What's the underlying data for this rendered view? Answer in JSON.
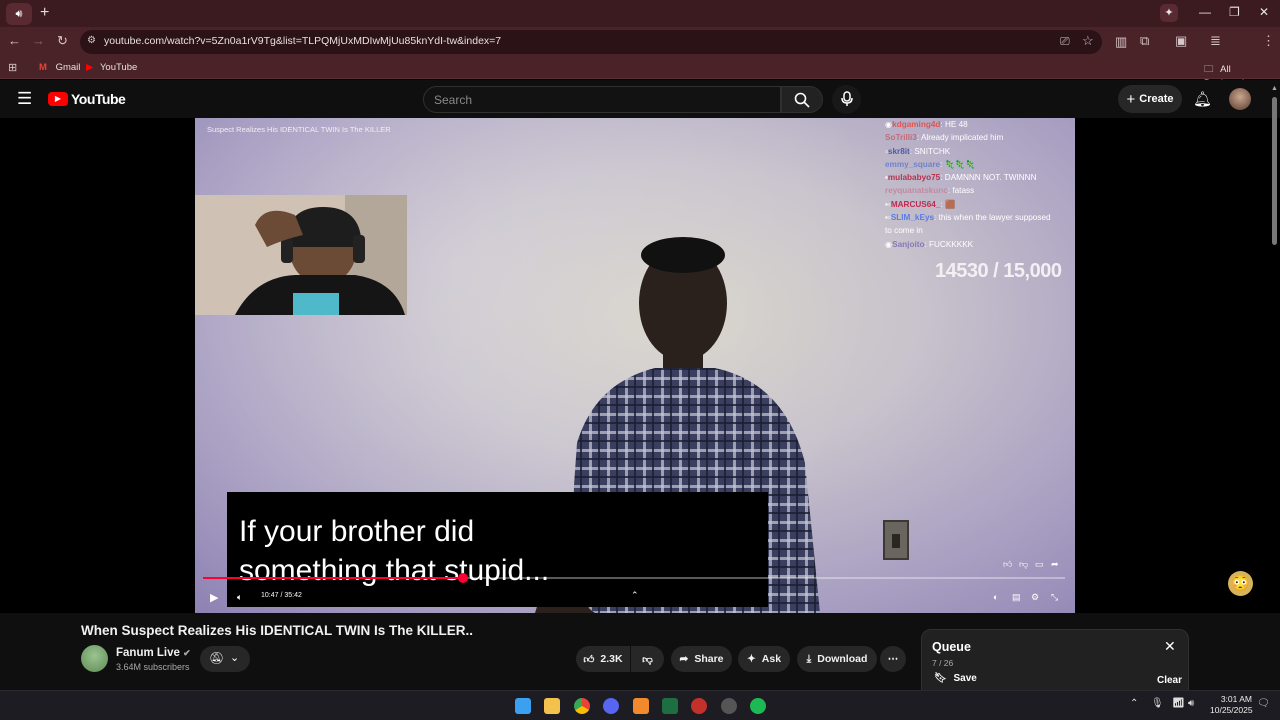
{
  "browser": {
    "url": "youtube.com/watch?v=5Zn0a1rV9Tg&list=TLPQMjUxMDIwMjUu85knYdI-tw&index=7",
    "bookmarks": [
      "Gmail",
      "YouTube"
    ],
    "all_bookmarks": "All Bookmarks",
    "new_tab": "+",
    "window_controls": [
      "—",
      "❐",
      "✕"
    ]
  },
  "youtube": {
    "logo_text": "YouTube",
    "search_placeholder": "Search",
    "create_label": "Create"
  },
  "video": {
    "overlay_title": "Suspect Realizes His IDENTICAL TWIN Is The KILLER",
    "chat": [
      {
        "user": "kdgaming4d",
        "msg": ": HE 48",
        "color": "#e0564f"
      },
      {
        "user": "SoTrilli3",
        "msg": ": Already implicated him",
        "color": "#c26b78"
      },
      {
        "user": "skr8it",
        "msg": ": SNITCHK",
        "color": "#4c5ba8"
      },
      {
        "user": "emmy_square",
        "msg": ": 🦎🦎🦎",
        "color": "#6f83c9"
      },
      {
        "user": "mulababyo75",
        "msg": ": DAMNNN NOT. TWINNN",
        "color": "#b8324c"
      },
      {
        "user": "reyquanatskunc",
        "msg": ": fatass",
        "color": "#c28aa0"
      },
      {
        "user": "MARCUS64_",
        "msg": ": 🟫",
        "color": "#c12a50"
      },
      {
        "user": "SLIM_kEys",
        "msg": ": this when the lawyer supposed to come in",
        "color": "#5a7de0"
      },
      {
        "user": "Sanjoito",
        "msg": ": FUCKKKKK",
        "color": "#8a76b8"
      }
    ],
    "counter": "14530 / 15,000",
    "subtitle_line1": "If your brother did",
    "subtitle_line2": "something that stupid...",
    "time": "10:47 / 35:42",
    "progress_fraction": 0.302
  },
  "info": {
    "title": "When Suspect Realizes His IDENTICAL TWIN Is The KILLER..",
    "channel": "Fanum Live",
    "subscribers": "3.64M subscribers",
    "likes": "2.3K",
    "share": "Share",
    "ask": "Ask",
    "download": "Download"
  },
  "queue": {
    "title": "Queue",
    "position": "7 / 26",
    "save": "Save",
    "clear": "Clear"
  },
  "taskbar": {
    "time": "3:01 AM",
    "date": "10/25/2025"
  }
}
